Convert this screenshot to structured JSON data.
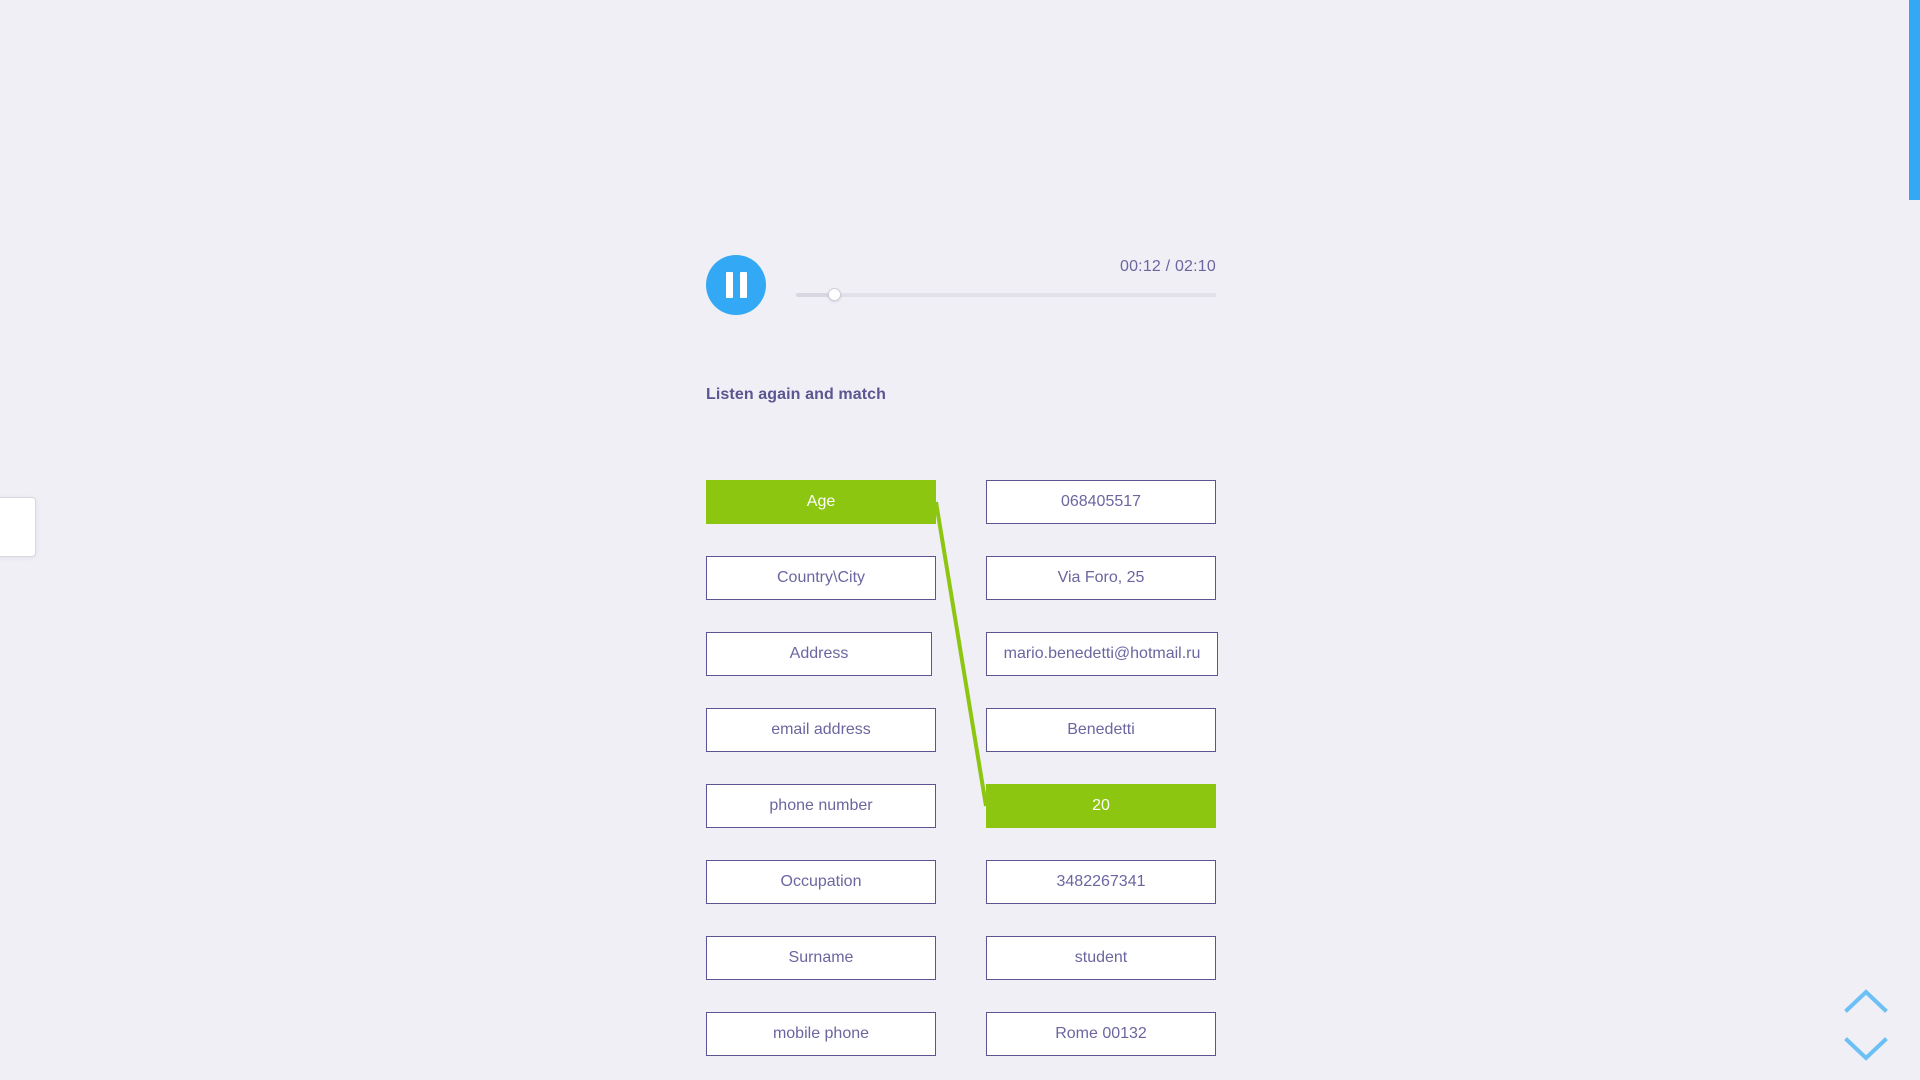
{
  "colors": {
    "background": "#f0eff5",
    "accent_blue": "#33a8f5",
    "selected_green": "#8cc610",
    "tile_border": "#5b5591",
    "text_purple": "#6b66a0",
    "menu_blue": "#29b6ec"
  },
  "side_menu": {
    "name": "menu-toggle",
    "icon": "hamburger-icon"
  },
  "scrollbar": {
    "thumb_position": "top"
  },
  "player": {
    "state": "playing",
    "play_icon": "pause-icon",
    "time_display": "00:12 / 02:10",
    "current_time": "00:12",
    "duration": "02:10",
    "progress_percent": 9
  },
  "prompt": {
    "text": "Listen again and match"
  },
  "match": {
    "left_column": [
      {
        "label": "Age",
        "selected": true,
        "width": "wide"
      },
      {
        "label": "Country\\City",
        "selected": false,
        "width": "wide"
      },
      {
        "label": "Address",
        "selected": false,
        "width": "narrow"
      },
      {
        "label": "email address",
        "selected": false,
        "width": "wide"
      },
      {
        "label": "phone number",
        "selected": false,
        "width": "wide"
      },
      {
        "label": "Occupation",
        "selected": false,
        "width": "wide"
      },
      {
        "label": "Surname",
        "selected": false,
        "width": "wide"
      },
      {
        "label": "mobile phone",
        "selected": false,
        "width": "wide"
      }
    ],
    "right_column": [
      {
        "label": "068405517",
        "selected": false,
        "width": "wide"
      },
      {
        "label": "Via Foro, 25",
        "selected": false,
        "width": "wide"
      },
      {
        "label": "mario.benedetti@hotmail.ru",
        "selected": false,
        "width": "xwide"
      },
      {
        "label": "Benedetti",
        "selected": false,
        "width": "wide"
      },
      {
        "label": "20",
        "selected": true,
        "width": "wide"
      },
      {
        "label": "3482267341",
        "selected": false,
        "width": "wide"
      },
      {
        "label": "student",
        "selected": false,
        "width": "wide"
      },
      {
        "label": "Rome 00132",
        "selected": false,
        "width": "wide"
      }
    ],
    "connections": [
      {
        "from_left_index": 0,
        "to_right_index": 4,
        "color": "#8cc610"
      }
    ]
  },
  "nav": {
    "up_label": "chevron-up-icon",
    "down_label": "chevron-down-icon"
  }
}
